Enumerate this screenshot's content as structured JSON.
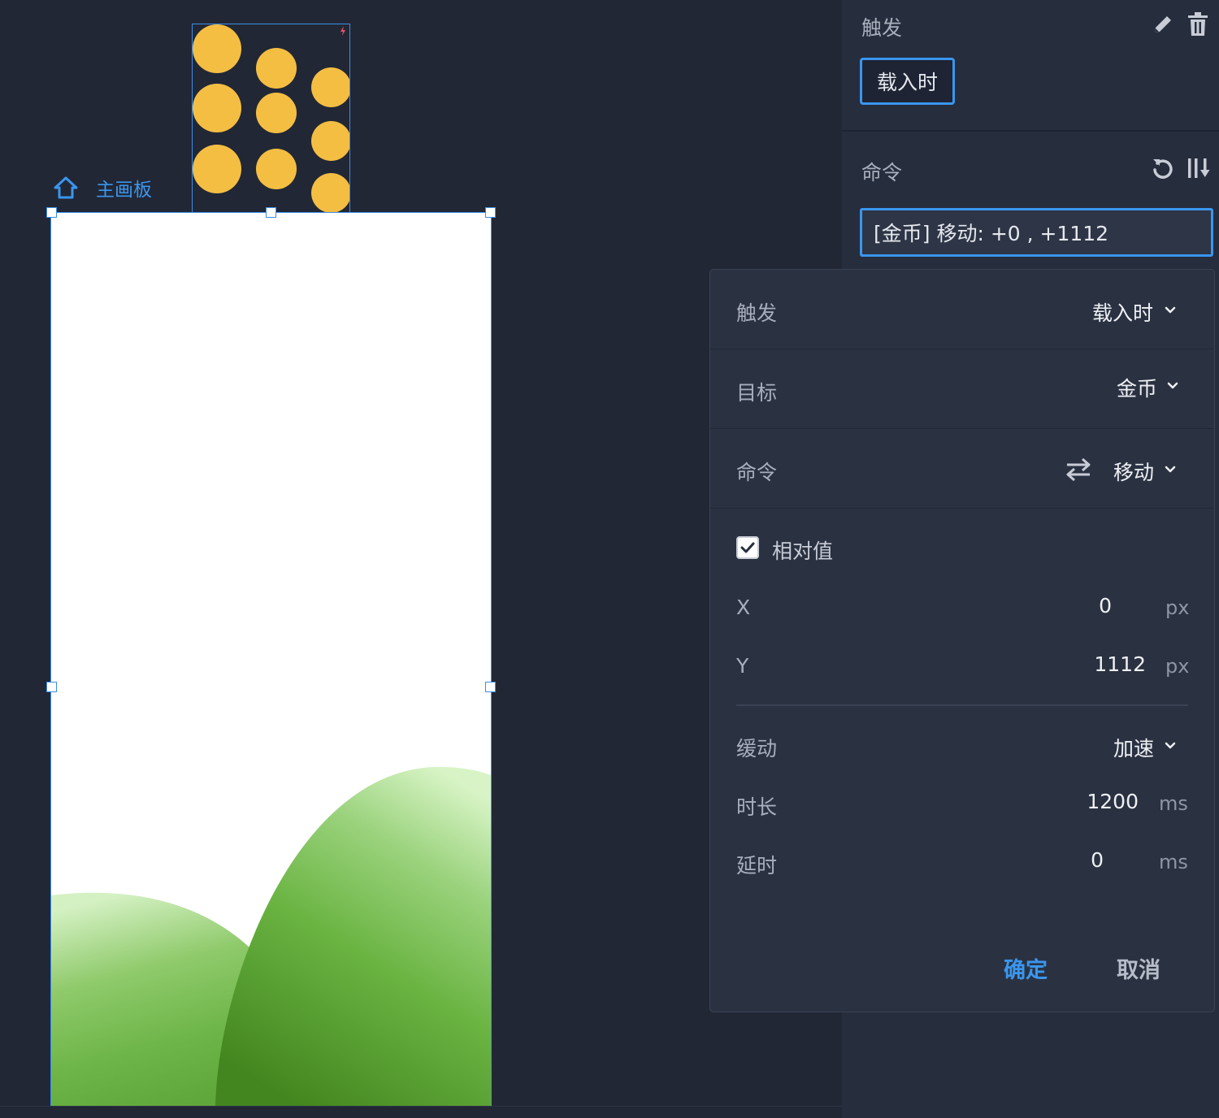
{
  "canvas": {
    "artboard_label": "主画板"
  },
  "panel": {
    "trigger_title": "触发",
    "trigger_chip": "载入时",
    "command_title": "命令",
    "command_summary": "[金币] 移动: +0 , +1112"
  },
  "popover": {
    "trigger": {
      "label": "触发",
      "value": "载入时"
    },
    "target": {
      "label": "目标",
      "value": "金币"
    },
    "command": {
      "label": "命令",
      "value": "移动"
    },
    "relative": {
      "label": "相对值",
      "checked": true
    },
    "x": {
      "label": "X",
      "value": "0",
      "unit": "px"
    },
    "y": {
      "label": "Y",
      "value": "1112",
      "unit": "px"
    },
    "easing": {
      "label": "缓动",
      "value": "加速"
    },
    "duration": {
      "label": "时长",
      "value": "1200",
      "unit": "ms"
    },
    "delay": {
      "label": "延时",
      "value": "0",
      "unit": "ms"
    },
    "confirm": "确定",
    "cancel": "取消"
  },
  "icons": {
    "home": "home-icon",
    "edit": "pencil-icon",
    "delete": "trash-icon",
    "reset": "undo-icon",
    "sort": "sort-icon",
    "swap": "swap-icon",
    "bolt": "lightning-icon"
  },
  "colors": {
    "accent": "#3a96ee",
    "coin": "#f4be43",
    "background": "#222735",
    "panel": "#262d3d"
  }
}
